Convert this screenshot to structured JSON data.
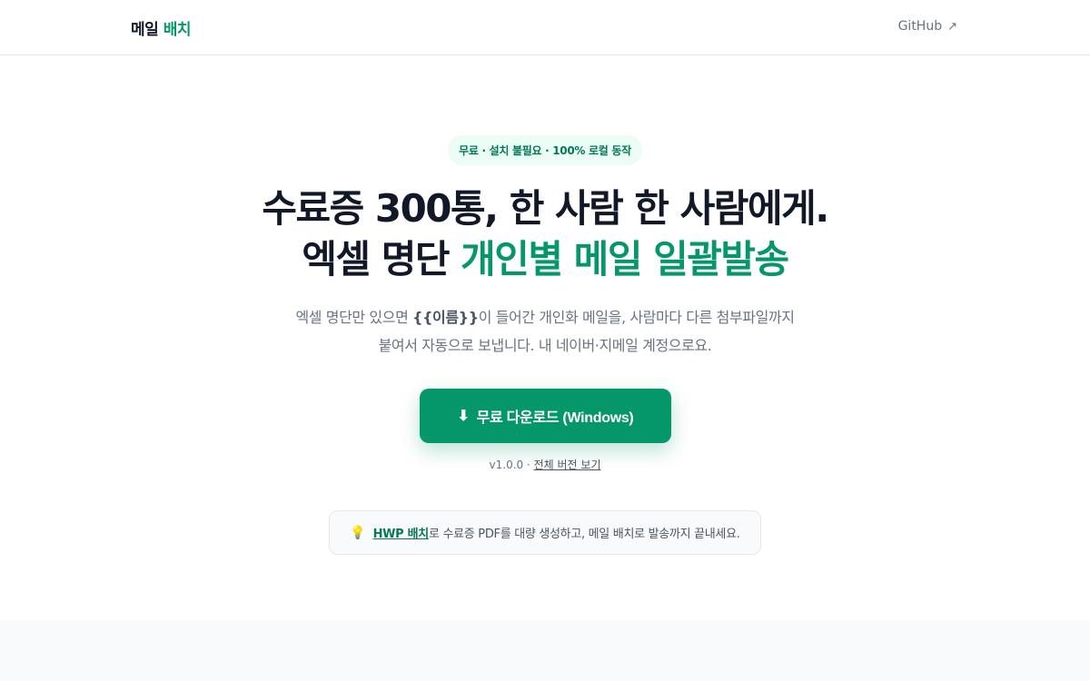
{
  "header": {
    "brand_prefix": "메일",
    "brand_accent": "배치",
    "github_label": "GitHub",
    "github_arrow": "↗"
  },
  "hero": {
    "pill": "무료 · 설치 불필요 · 100% 로컬 동작",
    "headline_line1": "수료증 300통, 한 사람 한 사람에게.",
    "headline_line2_plain": "엑셀 명단",
    "headline_line2_accent": "개인별 메일 일괄발송",
    "desc_part1": "엑셀 명단만 있으면",
    "desc_tag": "{{이름}}",
    "desc_part2": "이 들어간 개인화 메일을, 사람마다 다른 첨부파일까지",
    "desc_line2": "붙여서 자동으로 보냅니다. 내 네이버·지메일 계정으로요."
  },
  "download": {
    "icon": "⬇",
    "label": "무료 다운로드 (Windows)"
  },
  "version": {
    "text": "v1.0.0 ·",
    "link": "전체 버전 보기"
  },
  "tip": {
    "icon": "💡",
    "link": "HWP 배치",
    "text": "로 수료증 PDF를 대량 생성하고, 메일 배치로 발송까지 끝내세요."
  },
  "colors": {
    "accent": "#059669",
    "accent_dark": "#047857",
    "pill_bg": "#ecfdf5"
  }
}
